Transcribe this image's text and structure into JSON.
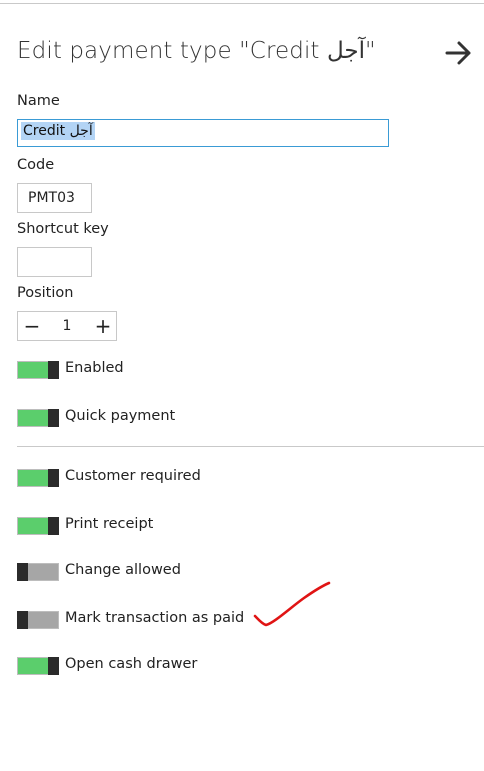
{
  "title": "Edit payment type \"Credit آجل\"",
  "icons": {
    "back": "arrow-right-icon",
    "annotation": "red-checkmark"
  },
  "colors": {
    "toggle_on": "#5bce6c",
    "toggle_off": "#a6a6a6",
    "focus_border": "#3a9bd5",
    "annotation": "#e01414"
  },
  "fields": {
    "name": {
      "label": "Name",
      "value": "Credit آجل"
    },
    "code": {
      "label": "Code",
      "value": "PMT03"
    },
    "shortcut": {
      "label": "Shortcut key",
      "value": ""
    },
    "position": {
      "label": "Position",
      "value": "1",
      "minus": "−",
      "plus": "+"
    }
  },
  "toggles": {
    "enabled": {
      "label": "Enabled",
      "on": true
    },
    "quick_payment": {
      "label": "Quick payment",
      "on": true
    },
    "customer_required": {
      "label": "Customer required",
      "on": true
    },
    "print_receipt": {
      "label": "Print receipt",
      "on": true
    },
    "change_allowed": {
      "label": "Change allowed",
      "on": false
    },
    "mark_paid": {
      "label": "Mark transaction as paid",
      "on": false
    },
    "open_cash_drawer": {
      "label": "Open cash drawer",
      "on": true
    }
  }
}
